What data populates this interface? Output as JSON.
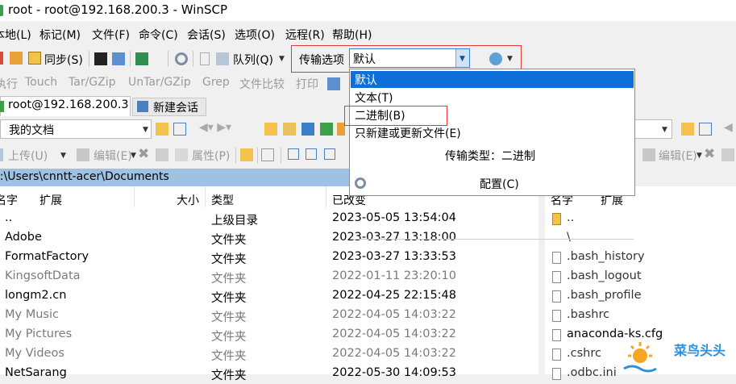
{
  "window": {
    "title": "root - root@192.168.200.3 - WinSCP"
  },
  "menu": [
    "本地(L)",
    "标记(M)",
    "文件(F)",
    "命令(C)",
    "会话(S)",
    "选项(O)",
    "远程(R)",
    "帮助(H)"
  ],
  "toolbar1": {
    "sync": "同步(S)",
    "queue": "队列(Q)",
    "transfer_options": "传输选项",
    "transfer_value": "默认"
  },
  "toolbar2": [
    "执行",
    "Touch",
    "Tar/GZip",
    "UnTar/GZip",
    "Grep",
    "文件比较",
    "打印"
  ],
  "dropdown": {
    "items": [
      "默认",
      "文本(T)",
      "二进制(B)",
      "只新建或更新文件(E)"
    ],
    "type_label": "传输类型：二进制",
    "config": "配置(C)"
  },
  "tabs": {
    "session": "root@192.168.200.3",
    "new_session": "新建会话"
  },
  "left": {
    "location": "我的文档",
    "upload": "上传(U)",
    "edit": "编辑(E)",
    "props": "属性(P)",
    "path": "C:\\Users\\cnntt-acer\\Documents",
    "headers": {
      "name": "名字",
      "ext": "扩展",
      "size": "大小",
      "type": "类型",
      "changed": "已改变"
    },
    "rows": [
      {
        "name": "..",
        "type": "上级目录",
        "date": "2023-05-05  13:54:04"
      },
      {
        "name": "Adobe",
        "type": "文件夹",
        "date": "2023-03-27  13:18:00"
      },
      {
        "name": "FormatFactory",
        "type": "文件夹",
        "date": "2023-03-27  13:33:53"
      },
      {
        "name": "KingsoftData",
        "type": "文件夹",
        "date": "2022-01-11  23:20:10"
      },
      {
        "name": "longm2.cn",
        "type": "文件夹",
        "date": "2022-04-25  22:15:48"
      },
      {
        "name": "My Music",
        "type": "文件夹",
        "date": "2022-04-05  14:03:22"
      },
      {
        "name": "My Pictures",
        "type": "文件夹",
        "date": "2022-04-05  14:03:22"
      },
      {
        "name": "My Videos",
        "type": "文件夹",
        "date": "2022-04-05  14:03:22"
      },
      {
        "name": "NetSarang",
        "type": "文件夹",
        "date": "2022-05-30  14:09:53"
      }
    ]
  },
  "right": {
    "edit": "编辑(E)",
    "headers": {
      "name": "名字",
      "ext": "扩展"
    },
    "rows": [
      "..",
      "\\",
      ".bash_history",
      ".bash_logout",
      ".bash_profile",
      ".bashrc",
      "anaconda-ks.cfg",
      ".cshrc",
      ".odbc.ini"
    ]
  },
  "watermark": {
    "text": "菜鸟头头"
  }
}
